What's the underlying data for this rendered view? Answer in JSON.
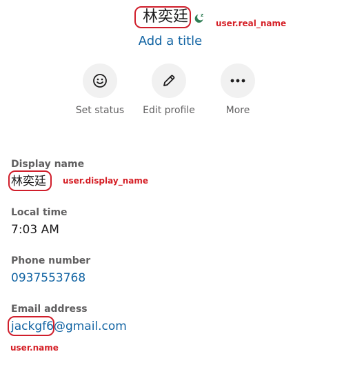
{
  "user": {
    "real_name": "林奕廷",
    "title_placeholder": "Add a title",
    "status_icon": "away-zzz-icon",
    "display_name": "林奕廷",
    "local_time": "7:03 AM",
    "phone": "0937553768",
    "email_user": "jackgf6",
    "email_domain": "@gmail.com"
  },
  "actions": [
    {
      "label": "Set status",
      "icon": "smiley-icon"
    },
    {
      "label": "Edit profile",
      "icon": "pencil-icon"
    },
    {
      "label": "More",
      "icon": "ellipsis-icon"
    }
  ],
  "fields": {
    "display_name_label": "Display name",
    "local_time_label": "Local time",
    "phone_label": "Phone number",
    "email_label": "Email address"
  },
  "annotations": {
    "real_name": "user.real_name",
    "display_name": "user.display_name",
    "user_name": "user.name"
  },
  "colors": {
    "link": "#1264a3",
    "annotation": "#d51f26",
    "away_status": "#2e7d54",
    "button_bg": "#f1f1f1",
    "muted_text": "#616061"
  }
}
